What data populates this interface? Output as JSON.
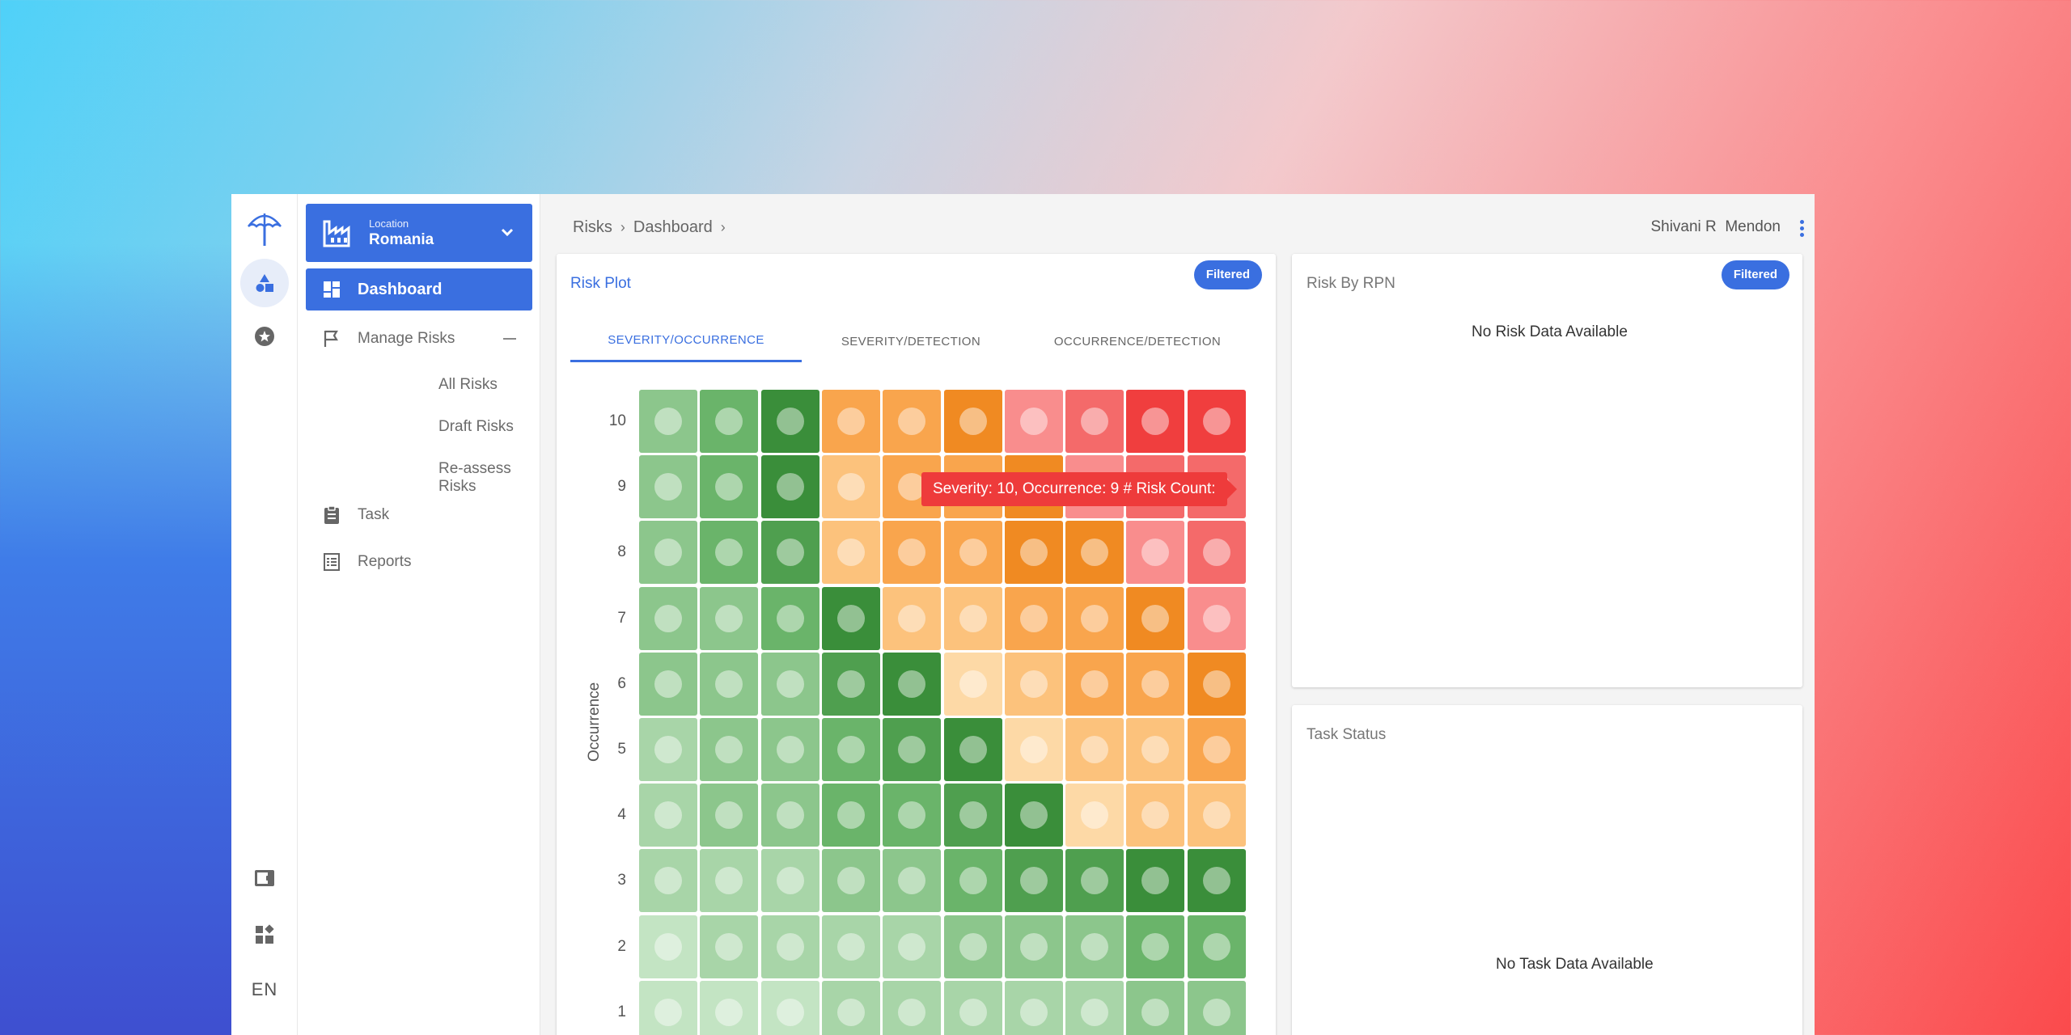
{
  "sidebar": {
    "location_label": "Location",
    "location_value": "Romania",
    "items": [
      {
        "label": "Dashboard"
      },
      {
        "label": "Manage Risks"
      },
      {
        "label": "Task"
      },
      {
        "label": "Reports"
      }
    ],
    "sub_items": [
      {
        "label": "All Risks"
      },
      {
        "label": "Draft Risks"
      },
      {
        "label": "Re-assess Risks"
      }
    ],
    "language": "EN"
  },
  "breadcrumb": {
    "items": [
      "Risks",
      "Dashboard"
    ]
  },
  "user": {
    "name": "Shivani R  Mendon"
  },
  "risk_plot": {
    "title": "Risk Plot",
    "badge": "Filtered",
    "tabs": [
      "SEVERITY/OCCURRENCE",
      "SEVERITY/DETECTION",
      "OCCURRENCE/DETECTION"
    ],
    "active_tab": 0,
    "tooltip": "Severity: 10, Occurrence: 9 # Risk Count:"
  },
  "chart_data": {
    "type": "heatmap",
    "ylabel": "Occurrence",
    "y_ticks": [
      10,
      9,
      8,
      7,
      6,
      5,
      4,
      3,
      2,
      1
    ],
    "columns": 10,
    "colors": {
      "g1": "#c3e4c3",
      "g2": "#a8d5a8",
      "g3": "#8cc68c",
      "g4": "#6ab46a",
      "g5": "#4f9f4f",
      "g6": "#3a8e3a",
      "o1": "#fdd9a6",
      "o2": "#fcc27c",
      "o3": "#f9a54d",
      "o4": "#f08a22",
      "r1": "#f98d8d",
      "r2": "#f46a6a",
      "r3": "#f03e3e"
    },
    "cells": [
      [
        "g3",
        "g4",
        "g6",
        "o3",
        "o3",
        "o4",
        "r1",
        "r2",
        "r3",
        "r3"
      ],
      [
        "g3",
        "g4",
        "g6",
        "o2",
        "o3",
        "o3",
        "o4",
        "r1",
        "r2",
        "r2"
      ],
      [
        "g3",
        "g4",
        "g5",
        "o2",
        "o3",
        "o3",
        "o4",
        "o4",
        "r1",
        "r2"
      ],
      [
        "g3",
        "g3",
        "g4",
        "g6",
        "o2",
        "o2",
        "o3",
        "o3",
        "o4",
        "r1"
      ],
      [
        "g3",
        "g3",
        "g3",
        "g5",
        "g6",
        "o1",
        "o2",
        "o3",
        "o3",
        "o4"
      ],
      [
        "g2",
        "g3",
        "g3",
        "g4",
        "g5",
        "g6",
        "o1",
        "o2",
        "o2",
        "o3"
      ],
      [
        "g2",
        "g3",
        "g3",
        "g4",
        "g4",
        "g5",
        "g6",
        "o1",
        "o2",
        "o2"
      ],
      [
        "g2",
        "g2",
        "g2",
        "g3",
        "g3",
        "g4",
        "g5",
        "g5",
        "g6",
        "g6"
      ],
      [
        "g1",
        "g2",
        "g2",
        "g2",
        "g2",
        "g3",
        "g3",
        "g3",
        "g4",
        "g4"
      ],
      [
        "g1",
        "g1",
        "g1",
        "g2",
        "g2",
        "g2",
        "g2",
        "g2",
        "g3",
        "g3"
      ]
    ]
  },
  "risk_by_rpn": {
    "title": "Risk By RPN",
    "badge": "Filtered",
    "empty": "No Risk Data Available"
  },
  "task_status": {
    "title": "Task Status",
    "empty": "No Task Data Available"
  }
}
